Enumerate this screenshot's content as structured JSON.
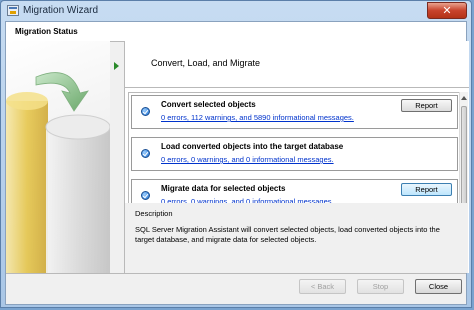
{
  "window": {
    "title": "Migration Wizard",
    "close_glyph": "✕"
  },
  "header": {
    "label": "Migration Status"
  },
  "step": {
    "title": "Convert, Load, and Migrate"
  },
  "steps": [
    {
      "name": "Convert selected objects",
      "summary": "0 errors, 112 warnings, and 5890 informational messages.",
      "report_label": "Report"
    },
    {
      "name": "Load converted objects into the target database",
      "summary": "0 errors, 0 warnings, and 0 informational messages."
    },
    {
      "name": "Migrate data for selected objects",
      "summary": "0 errors, 0 warnings, and 0 informational messages.",
      "report_label": "Report"
    }
  ],
  "description": {
    "label": "Description",
    "text": "SQL Server Migration Assistant will convert selected objects, load converted objects into the target database, and migrate data for selected objects."
  },
  "footer": {
    "back_label": "< Back",
    "stop_label": "Stop",
    "close_label": "Close"
  },
  "icons": {
    "app": "app-icon",
    "close": "close-icon",
    "check": "check-circle-icon",
    "play": "play-arrow-icon",
    "illustration": "database-migrate-illustration"
  },
  "colors": {
    "link": "#0033cc",
    "check": "#1b6fd0",
    "close_button": "#c8432c",
    "arrow": "#6aa86a",
    "gold_cylinder": "#e3bd2a"
  }
}
